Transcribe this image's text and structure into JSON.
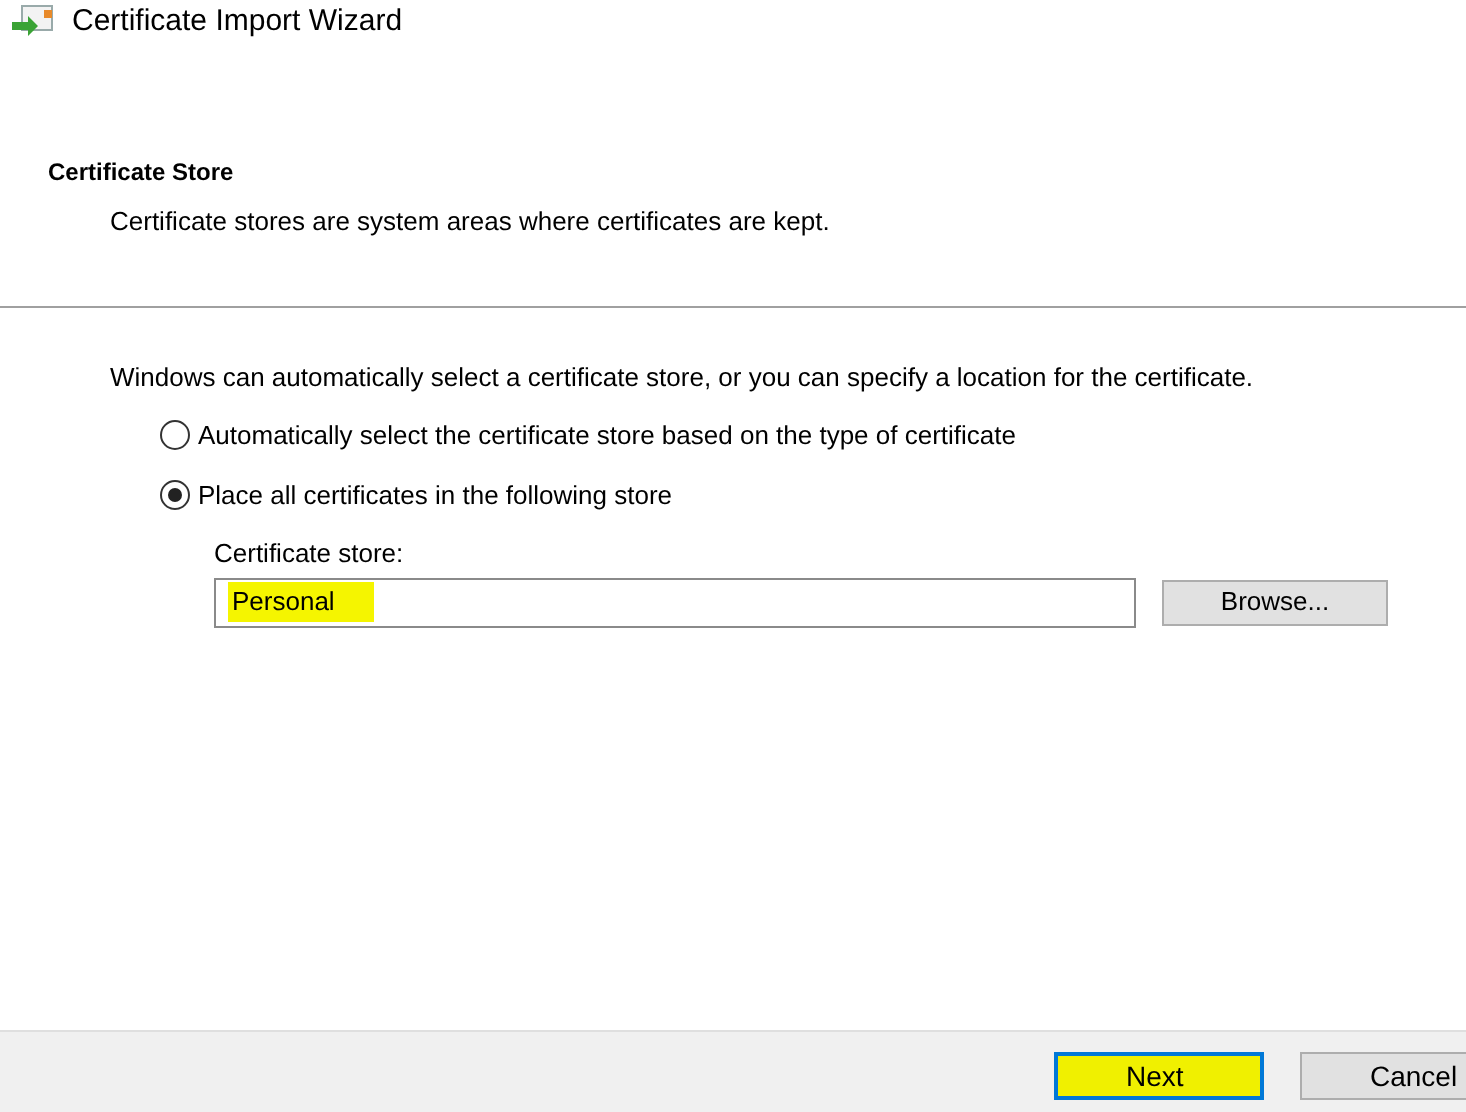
{
  "window": {
    "title": "Certificate Import Wizard"
  },
  "header": {
    "title": "Certificate Store",
    "subtitle": "Certificate stores are system areas where certificates are kept."
  },
  "intro": "Windows can automatically select a certificate store, or you can specify a location for the certificate.",
  "options": [
    {
      "label": "Automatically select the certificate store based on the type of certificate",
      "selected": false
    },
    {
      "label": "Place all certificates in the following store",
      "selected": true
    }
  ],
  "store": {
    "label": "Certificate store:",
    "value": "Personal",
    "highlighted": true,
    "browse": "Browse..."
  },
  "buttons": [
    {
      "label": "Next",
      "default": true,
      "highlighted": true
    },
    {
      "label": "Cancel",
      "default": false,
      "highlighted": false
    }
  ]
}
